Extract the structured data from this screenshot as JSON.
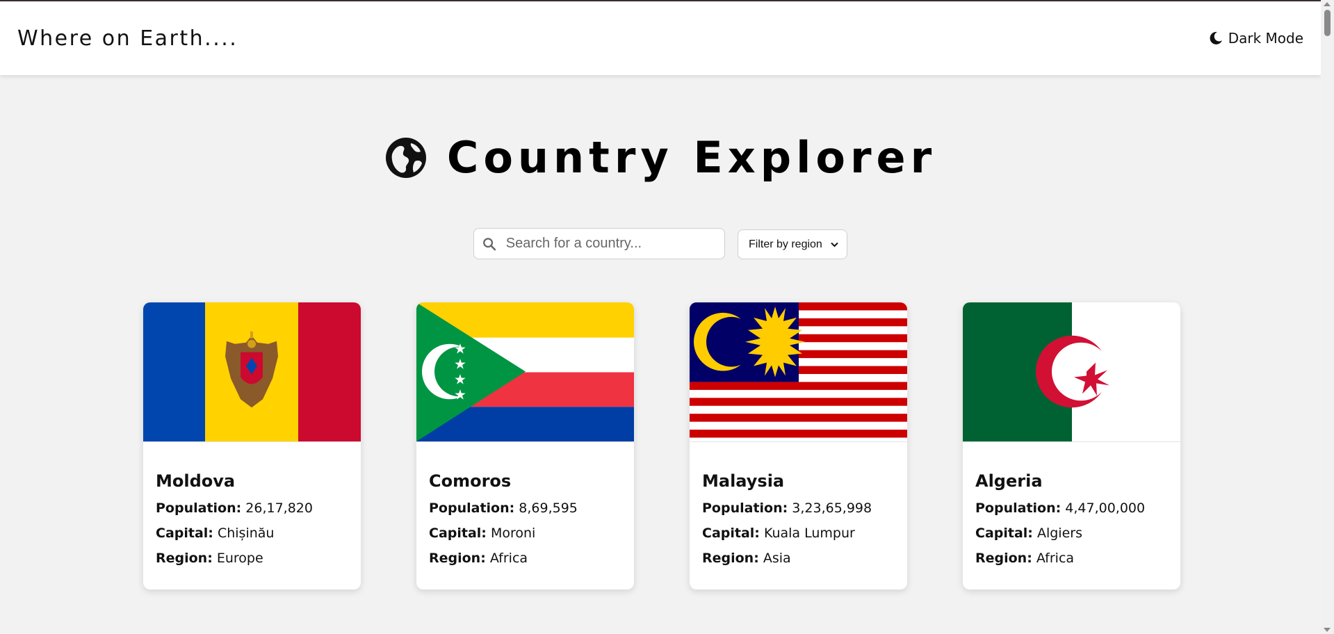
{
  "navbar": {
    "brand": "Where on Earth....",
    "mode_label": "Dark Mode",
    "mode_icon": "moon-icon"
  },
  "hero": {
    "icon": "globe-icon",
    "title": "Country Explorer"
  },
  "search": {
    "icon": "search-icon",
    "placeholder": "Search for a country...",
    "value": ""
  },
  "filter": {
    "selected": "Filter by region",
    "icon": "chevron-down-icon"
  },
  "labels": {
    "population": "Population:",
    "capital": "Capital:",
    "region": "Region:"
  },
  "countries": [
    {
      "name": "Moldova",
      "population": "26,17,820",
      "capital": "Chișinău",
      "region": "Europe",
      "flag_colors": [
        "#0046ae",
        "#ffd200",
        "#cc092f"
      ]
    },
    {
      "name": "Comoros",
      "population": "8,69,595",
      "capital": "Moroni",
      "region": "Africa",
      "flag_colors": [
        "#ffd100",
        "#ffffff",
        "#ef3340",
        "#003da5",
        "#009543"
      ]
    },
    {
      "name": "Malaysia",
      "population": "3,23,65,998",
      "capital": "Kuala Lumpur",
      "region": "Asia",
      "flag_colors": [
        "#cc0001",
        "#ffffff",
        "#010066",
        "#ffcc00"
      ]
    },
    {
      "name": "Algeria",
      "population": "4,47,00,000",
      "capital": "Algiers",
      "region": "Africa",
      "flag_colors": [
        "#006233",
        "#ffffff",
        "#d21034"
      ]
    }
  ]
}
